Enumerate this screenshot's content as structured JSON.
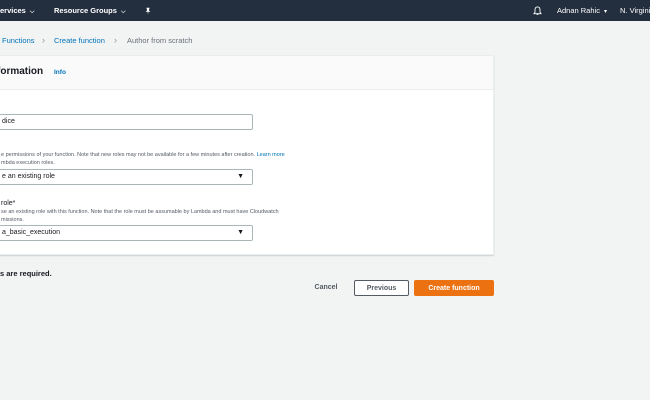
{
  "topnav": {
    "services": "ervices",
    "resource_groups": "Resource Groups",
    "pin_icon": "pin-icon",
    "bell_icon": "bell-icon",
    "user": "Adnan Rahic",
    "region": "N. Virgini"
  },
  "breadcrumb": {
    "functions": "Functions",
    "create_function": "Create function",
    "current": "Author from scratch"
  },
  "panel": {
    "title": "formation",
    "info": "Info",
    "name_value": "dice",
    "role_desc_1": "e permissions of your function. Note that new roles may not be available for a few minutes after creation.",
    "role_desc_link": "Learn more",
    "role_desc_2": "mbda execution roles.",
    "role_select": "e an existing role",
    "existing_role_label": "role*",
    "existing_role_desc_1": "se an existing role with this function. Note that the role must be assumable by Lambda and must have Cloudwatch",
    "existing_role_desc_2": "missions.",
    "existing_role_value": "a_basic_execution"
  },
  "footer": {
    "required_note": "s are required.",
    "cancel": "Cancel",
    "previous": "Previous",
    "create": "Create function"
  },
  "colors": {
    "nav_bg": "#232f3e",
    "link": "#0073bb",
    "primary": "#ec7211"
  }
}
